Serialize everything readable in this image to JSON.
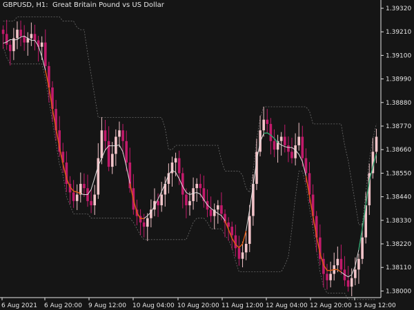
{
  "window": {
    "title": "GBPUSD, H1:  Great Britain Pound vs US Dollar",
    "background": "#151515",
    "text_color": "#e6e6e6"
  },
  "colors": {
    "candle_bull": "#f2c4c9",
    "candle_bear": "#c21a6b",
    "price_line": "#e0e0e0",
    "channel": "#6e6e6e",
    "signal_up": "#2fa36e",
    "signal_down": "#e05a10"
  },
  "chart_data": {
    "type": "candlestick",
    "symbol": "GBPUSD",
    "timeframe": "H1",
    "y_ticks": [
      "1.39320",
      "1.39210",
      "1.39100",
      "1.38990",
      "1.38880",
      "1.38770",
      "1.38660",
      "1.38550",
      "1.38440",
      "1.38330",
      "1.38220",
      "1.38110",
      "1.38000"
    ],
    "x_ticks": [
      "6 Aug 2021",
      "6 Aug 20:00",
      "9 Aug 12:00",
      "10 Aug 04:00",
      "10 Aug 20:00",
      "11 Aug 12:00",
      "12 Aug 04:00",
      "12 Aug 20:00",
      "13 Aug 12:00"
    ],
    "ylim": [
      1.3794,
      1.3936
    ],
    "closes": [
      1.392,
      1.3915,
      1.3912,
      1.3918,
      1.3922,
      1.3919,
      1.3916,
      1.3918,
      1.392,
      1.3917,
      1.3914,
      1.3916,
      1.3905,
      1.3895,
      1.3885,
      1.3875,
      1.3865,
      1.386,
      1.385,
      1.3846,
      1.3842,
      1.3845,
      1.385,
      1.3848,
      1.3842,
      1.384,
      1.3845,
      1.3862,
      1.3875,
      1.387,
      1.3858,
      1.3864,
      1.3872,
      1.3875,
      1.387,
      1.386,
      1.3848,
      1.3838,
      1.3835,
      1.3832,
      1.383,
      1.3834,
      1.3838,
      1.3842,
      1.384,
      1.3845,
      1.385,
      1.3855,
      1.386,
      1.3862,
      1.3855,
      1.3845,
      1.384,
      1.3842,
      1.3848,
      1.385,
      1.3848,
      1.3842,
      1.3838,
      1.3835,
      1.3838,
      1.384,
      1.3836,
      1.3832,
      1.383,
      1.3826,
      1.382,
      1.3815,
      1.3818,
      1.3822,
      1.3835,
      1.385,
      1.3865,
      1.3875,
      1.388,
      1.3878,
      1.387,
      1.3866,
      1.387,
      1.3872,
      1.3868,
      1.3865,
      1.3862,
      1.3868,
      1.3872,
      1.3862,
      1.3855,
      1.3845,
      1.3835,
      1.3825,
      1.3815,
      1.3808,
      1.3805,
      1.3808,
      1.3812,
      1.3815,
      1.381,
      1.3805,
      1.3802,
      1.3806,
      1.381,
      1.3815,
      1.3825,
      1.384,
      1.3855,
      1.3865,
      1.3872
    ],
    "up_signal_ranges": [
      [
        74,
        78
      ],
      [
        101,
        106
      ]
    ],
    "down_signal_ranges": [
      [
        12,
        22
      ],
      [
        36,
        40
      ],
      [
        63,
        69
      ],
      [
        86,
        96
      ]
    ]
  }
}
